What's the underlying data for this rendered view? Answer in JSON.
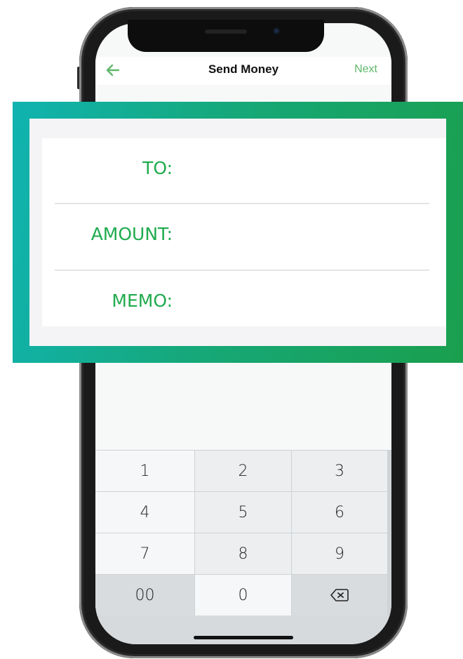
{
  "nav": {
    "title": "Send Money",
    "next_label": "Next",
    "back_icon": "arrow-left-icon",
    "accent_color": "#5fb86a"
  },
  "form": {
    "fields": [
      {
        "label": "TO:",
        "value": ""
      },
      {
        "label": "AMOUNT:",
        "value": ""
      },
      {
        "label": "MEMO:",
        "value": ""
      }
    ],
    "label_color": "#1fab4e"
  },
  "keypad": {
    "keys": [
      "1",
      "2",
      "3",
      "4",
      "5",
      "6",
      "7",
      "8",
      "9",
      "00",
      "0"
    ],
    "delete_icon": "backspace-icon"
  },
  "callout_gradient": [
    "#10b3b0",
    "#1a9f4e"
  ]
}
